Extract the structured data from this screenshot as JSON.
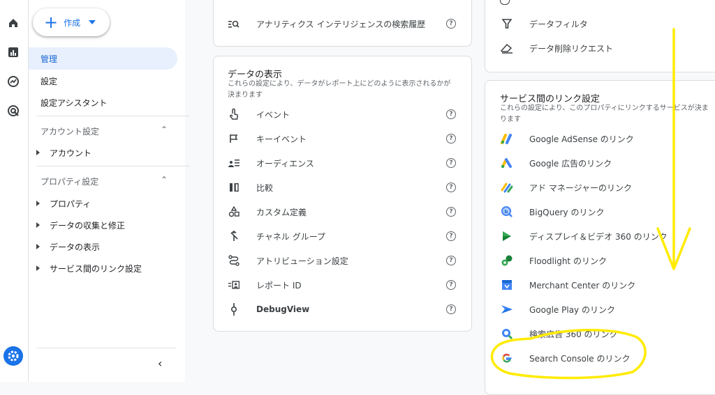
{
  "create_button": {
    "label": "作成"
  },
  "nav": {
    "active": "管理",
    "items": [
      "設定",
      "設定アシスタント"
    ],
    "account_section": {
      "title": "アカウント設定",
      "items": [
        "アカウント"
      ]
    },
    "property_section": {
      "title": "プロパティ設定",
      "items": [
        "プロパティ",
        "データの収集と修正",
        "データの表示",
        "サービス間のリンク設定"
      ]
    }
  },
  "top_middle": {
    "item": "アナリティクス インテリジェンスの検索履歴"
  },
  "data_display": {
    "title": "データの表示",
    "description": "これらの設定により、データがレポート上にどのように表示されるかが決まります",
    "items": [
      "イベント",
      "キーイベント",
      "オーディエンス",
      "比較",
      "カスタム定義",
      "チャネル グループ",
      "アトリビューション設定",
      "レポート ID",
      "DebugView"
    ]
  },
  "top_right": {
    "items": [
      "データフィルタ",
      "データ削除リクエスト"
    ]
  },
  "service_links": {
    "title": "サービス間のリンク設定",
    "description": "これらの設定により、このプロパティにリンクするサービスが決まります",
    "items": [
      "Google AdSense のリンク",
      "Google 広告のリンク",
      "アド マネージャーのリンク",
      "BigQuery のリンク",
      "ディスプレイ＆ビデオ 360 のリンク",
      "Floodlight のリンク",
      "Merchant Center のリンク",
      "Google Play のリンク",
      "検索広告 360 のリンク",
      "Search Console のリンク"
    ]
  },
  "colors": {
    "accent": "#1a73e8",
    "active_bg": "#e8f0fe",
    "annotation": "#ffeb00"
  }
}
